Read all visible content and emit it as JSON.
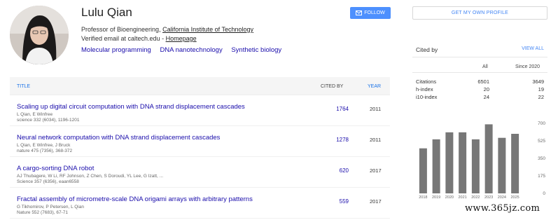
{
  "profile": {
    "name": "Lulu Qian",
    "affiliation_prefix": "Professor of Bioengineering, ",
    "affiliation_link": "California Institute of Technology",
    "email_prefix": "Verified email at caltech.edu - ",
    "homepage_label": "Homepage",
    "interests": [
      "Molecular programming",
      "DNA nanotechnology",
      "Synthetic biology"
    ]
  },
  "buttons": {
    "follow": "FOLLOW",
    "get_profile": "GET MY OWN PROFILE"
  },
  "table": {
    "header": {
      "title": "TITLE",
      "cited_by": "CITED BY",
      "year": "YEAR"
    },
    "rows": [
      {
        "title": "Scaling up digital circuit computation with DNA strand displacement cascades",
        "authors": "L Qian, E Winfree",
        "venue": "science 332 (6034), 1196-1201",
        "cited": "1764",
        "year": "2011"
      },
      {
        "title": "Neural network computation with DNA strand displacement cascades",
        "authors": "L Qian, E Winfree, J Bruck",
        "venue": "nature 475 (7356), 368-372",
        "cited": "1278",
        "year": "2011"
      },
      {
        "title": "A cargo-sorting DNA robot",
        "authors": "AJ Thubagere, W Li, RF Johnson, Z Chen, S Doroudi, YL Lee, G Izatt, ...",
        "venue": "Science 357 (6356), eaan6558",
        "cited": "620",
        "year": "2017"
      },
      {
        "title": "Fractal assembly of micrometre-scale DNA origami arrays with arbitrary patterns",
        "authors": "G Tikhomirov, P Petersen, L Qian",
        "venue": "Nature 552 (7683), 67-71",
        "cited": "559",
        "year": "2017"
      }
    ]
  },
  "cited_by": {
    "title": "Cited by",
    "view_all": "VIEW ALL",
    "col_all": "All",
    "col_since": "Since 2020",
    "rows": [
      {
        "label": "Citations",
        "all": "6501",
        "since": "3649"
      },
      {
        "label": "h-index",
        "all": "20",
        "since": "19"
      },
      {
        "label": "i10-index",
        "all": "24",
        "since": "22"
      }
    ]
  },
  "chart_data": {
    "type": "bar",
    "categories": [
      "2018",
      "2019",
      "2020",
      "2021",
      "2022",
      "2023",
      "2024",
      "2025"
    ],
    "values": [
      450,
      540,
      610,
      610,
      540,
      690,
      555,
      595
    ],
    "ylim": [
      0,
      700
    ],
    "yticks": [
      "700",
      "525",
      "350",
      "175",
      "0"
    ],
    "bar_color": "#777777"
  },
  "watermark": "www.365jz.com",
  "colors": {
    "link": "#1a0dab",
    "accent": "#4d90fe",
    "header_bg": "#f5f5f5"
  }
}
